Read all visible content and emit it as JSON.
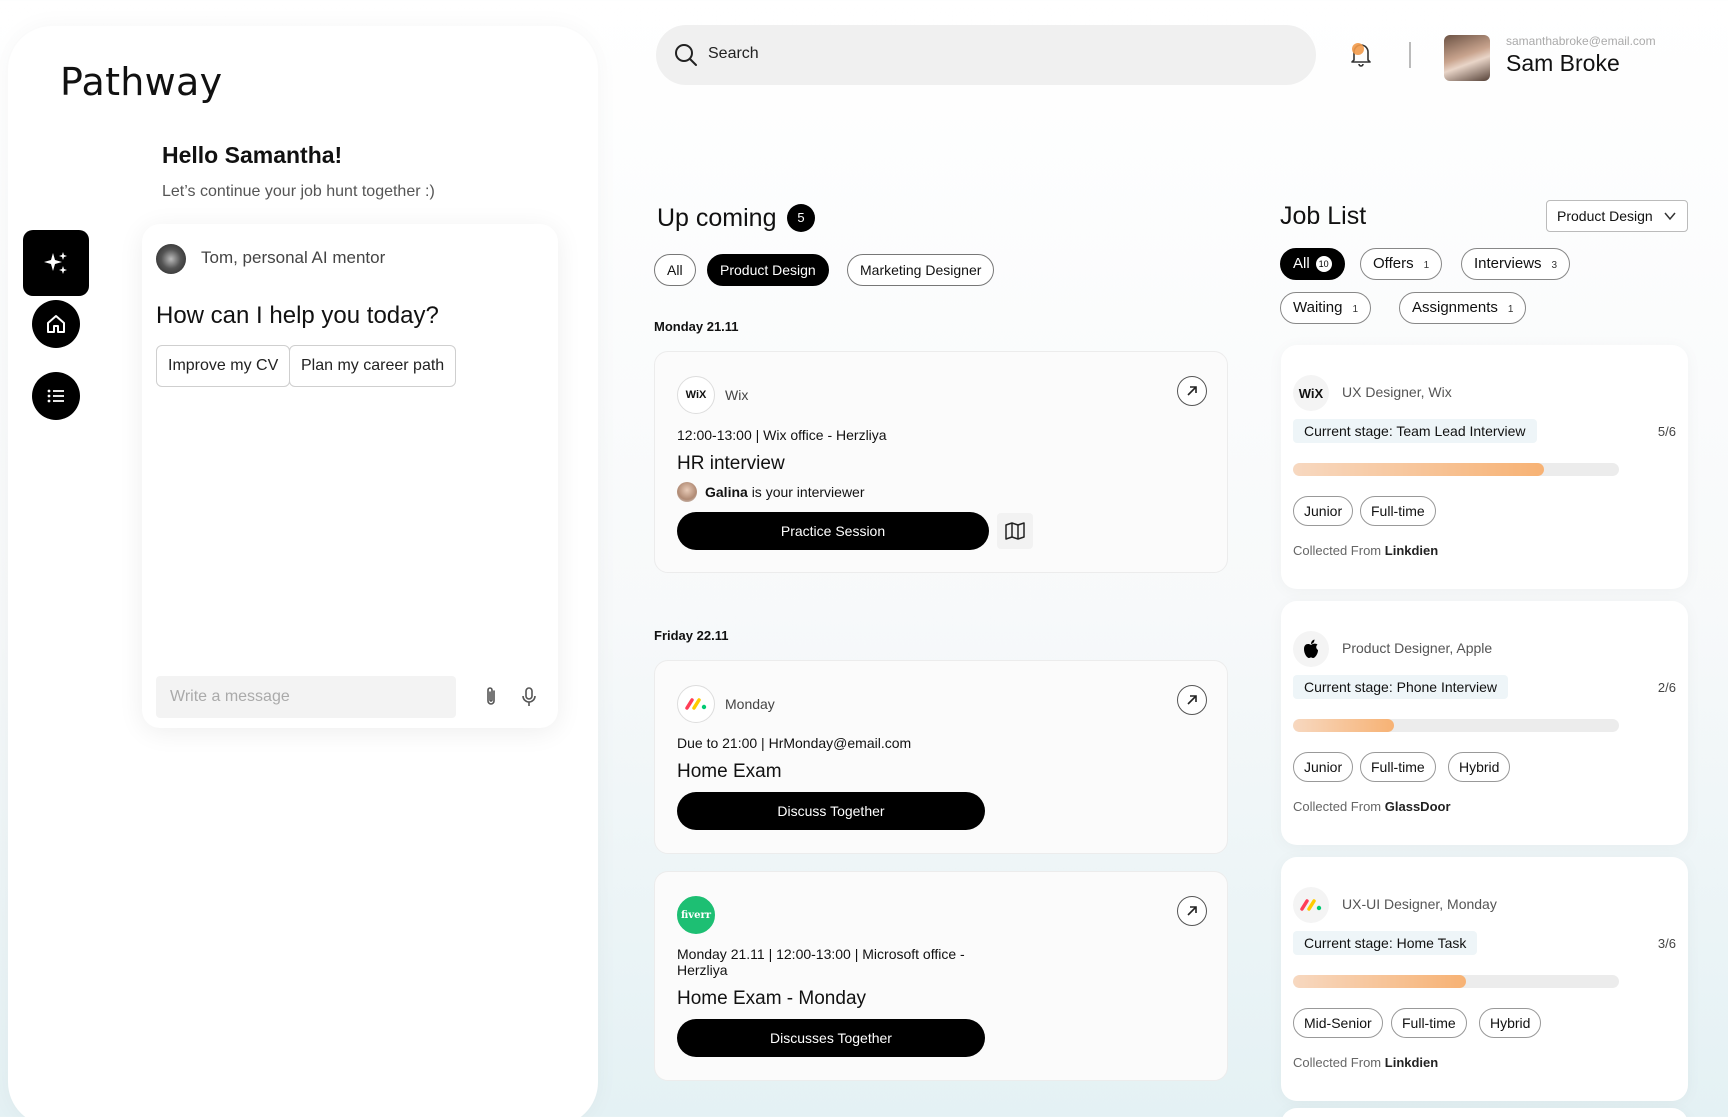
{
  "app": {
    "name": "Pathway"
  },
  "greeting": {
    "title": "Hello Samantha!",
    "subtitle": "Let’s continue your job hunt together :)"
  },
  "mentor": {
    "name": "Tom, personal AI mentor",
    "question": "How can I help you today?",
    "suggestions": [
      "Improve my CV",
      "Plan my career path"
    ],
    "input_placeholder": "Write a message"
  },
  "header": {
    "search_placeholder": "Search",
    "user": {
      "email": "samanthabroke@email.com",
      "name": "Sam Broke"
    }
  },
  "upcoming": {
    "title": "Up coming",
    "count": "5",
    "filters": [
      "All",
      "Product Design",
      "Marketing Designer"
    ],
    "active_filter": "Product Design",
    "groups": [
      {
        "date": "Monday 21.11",
        "events": [
          {
            "company": "Wix",
            "logo_text": "WiX",
            "meta": "12:00-13:00  | Wix office - Herzliya",
            "title": "HR interview",
            "interviewer_name": "Galina",
            "interviewer_suffix": "is your interviewer",
            "button": "Practice Session"
          }
        ]
      },
      {
        "date": "Friday 22.11",
        "events": [
          {
            "company": "Monday",
            "meta": "Due to 21:00 | HrMonday@email.com",
            "title": "Home Exam",
            "button": "Discuss Together"
          },
          {
            "company": "fiverr",
            "logo_text": "fiverr",
            "meta": "Monday 21.11 | 12:00-13:00  | Microsoft office - Herzliya",
            "title": "Home Exam - Monday",
            "button": "Discusses Together"
          }
        ]
      }
    ]
  },
  "joblist": {
    "title": "Job List",
    "dropdown": "Product Design",
    "tabs": [
      {
        "label": "All",
        "count": "10"
      },
      {
        "label": "Offers",
        "count": "1"
      },
      {
        "label": "Interviews",
        "count": "3"
      },
      {
        "label": "Waiting",
        "count": "1"
      },
      {
        "label": "Assignments",
        "count": "1"
      }
    ],
    "collected_prefix": "Collected From",
    "jobs": [
      {
        "logo_text": "WiX",
        "title": "UX Designer, Wix",
        "stage": "Current stage: Team Lead Interview",
        "fraction": "5/6",
        "progress": 0.77,
        "tags": [
          "Junior",
          "Full-time"
        ],
        "source": "Linkdien"
      },
      {
        "title": "Product Designer, Apple",
        "stage": "Current stage: Phone Interview",
        "fraction": "2/6",
        "progress": 0.31,
        "tags": [
          "Junior",
          "Full-time",
          "Hybrid"
        ],
        "source": "GlassDoor"
      },
      {
        "title": "UX-UI Designer, Monday",
        "stage": "Current stage: Home Task",
        "fraction": "3/6",
        "progress": 0.53,
        "tags": [
          "Mid-Senior",
          "Full-time",
          "Hybrid"
        ],
        "source": "Linkdien"
      }
    ]
  },
  "colors": {
    "accent": "#000000",
    "progress_start": "#f7d8c0",
    "progress_end": "#f7b274",
    "fiverr_green": "#1dbf73",
    "bell_orange": "#f29a4a"
  }
}
